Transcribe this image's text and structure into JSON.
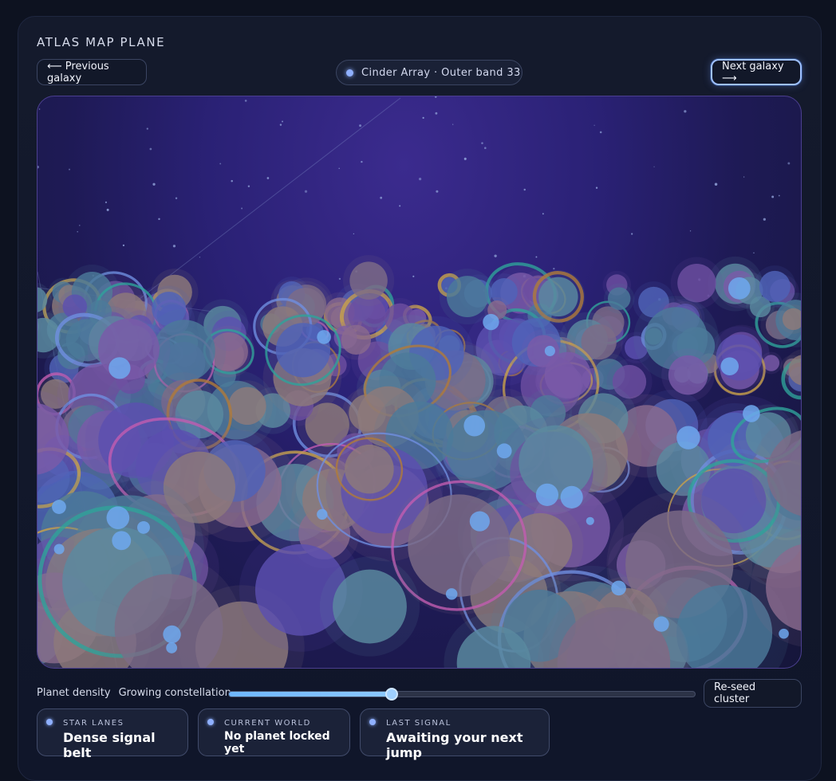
{
  "header": {
    "title": "ATLAS MAP PLANE",
    "prev_label": "⟵ Previous galaxy",
    "next_label": "Next galaxy ⟶",
    "location": "Cinder Array · Outer band 33"
  },
  "controls": {
    "density_label": "Planet density",
    "density_value": "Growing constellation",
    "density_level": 0.35,
    "reseed_label": "Re-seed cluster"
  },
  "cards": [
    {
      "key": "STAR LANES",
      "value": "Dense signal belt"
    },
    {
      "key": "CURRENT WORLD",
      "value": "No planet locked yet"
    },
    {
      "key": "LAST SIGNAL",
      "value": "Awaiting your next jump"
    }
  ],
  "colors": {
    "accent": "#8fb0ff",
    "slider": "#7dc0ff",
    "map_top": "#3b2b8e",
    "map_bottom": "#15163a"
  }
}
